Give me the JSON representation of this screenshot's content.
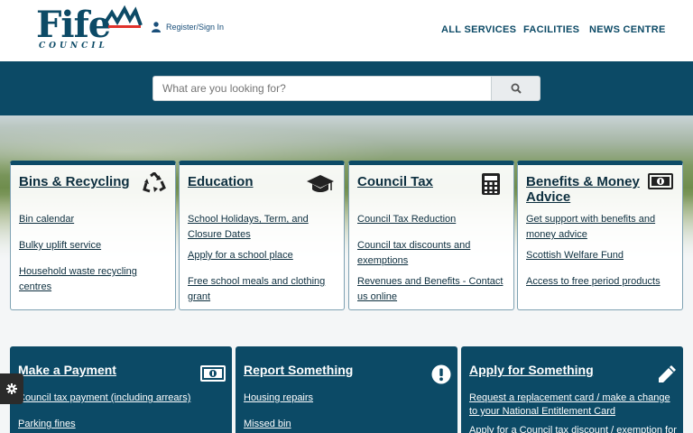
{
  "header": {
    "logo": {
      "text": "Fife",
      "sub": "COUNCIL"
    },
    "signin_label": "Register/Sign In",
    "nav": [
      {
        "label": "ALL SERVICES"
      },
      {
        "label": "FACILITIES"
      },
      {
        "label": "NEWS CENTRE"
      }
    ]
  },
  "search": {
    "placeholder": "What are you looking for?",
    "button_icon": "search-icon"
  },
  "cards": [
    {
      "title": "Bins & Recycling",
      "icon": "recycle-icon",
      "links": [
        "Bin calendar",
        "Bulky uplift service",
        "Household waste recycling centres"
      ]
    },
    {
      "title": "Education",
      "icon": "graduation-cap-icon",
      "links": [
        "School Holidays, Term, and Closure Dates",
        "Apply for a school place",
        "Free school meals and clothing grant"
      ]
    },
    {
      "title": "Council Tax",
      "icon": "calculator-icon",
      "links": [
        "Council Tax Reduction",
        "Council tax discounts and exemptions",
        "Revenues and Benefits - Contact us online"
      ]
    },
    {
      "title": "Benefits & Money Advice",
      "icon": "banknote-icon",
      "links": [
        "Get support with benefits and money advice",
        "Scottish Welfare Fund",
        "Access to free period products"
      ]
    }
  ],
  "action_cards": [
    {
      "title": "Make a Payment",
      "icon": "banknote-icon",
      "links": [
        "Council tax payment (including arrears)",
        "Parking fines"
      ]
    },
    {
      "title": "Report Something",
      "icon": "exclamation-icon",
      "links": [
        "Housing repairs",
        "Missed bin"
      ]
    },
    {
      "title": "Apply for Something",
      "icon": "pencil-icon",
      "links": [
        "Request a replacement card / make a change to your National Entitlement Card",
        "Apply for a Council tax discount / exemption for"
      ]
    }
  ],
  "colors": {
    "primary": "#0c4a66",
    "accent": "#e0322c"
  },
  "cookie_settings_icon": "gear-icon"
}
